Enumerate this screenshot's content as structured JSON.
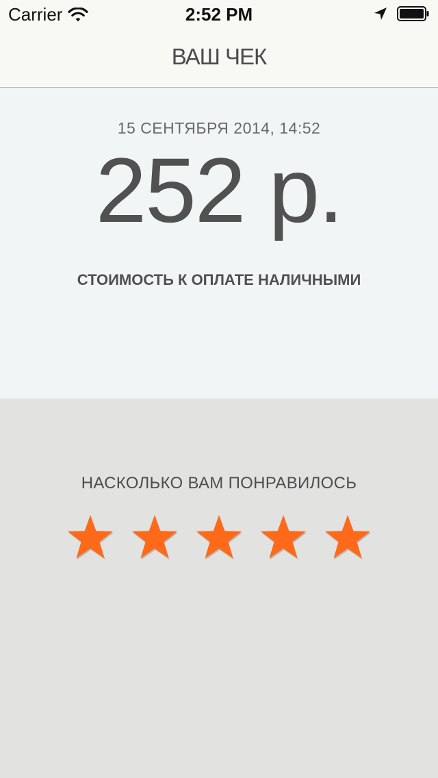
{
  "status_bar": {
    "carrier": "Carrier",
    "time": "2:52 PM",
    "icons": [
      "wifi-icon",
      "location-arrow-icon",
      "battery-icon"
    ]
  },
  "nav": {
    "title": "ВАШ ЧЕК"
  },
  "receipt": {
    "date": "15 СЕНТЯБРЯ 2014, 14:52",
    "amount": "252 р.",
    "caption": "СТОИМОСТЬ К ОПЛАТЕ НАЛИЧНЫМИ"
  },
  "rating": {
    "question": "НАСКОЛЬКО ВАМ ПОНРАВИЛОСЬ",
    "star_count": 5,
    "selected": 5,
    "star_color": "#ff6a1a"
  },
  "colors": {
    "nav_background": "#f8f8f4",
    "receipt_background": "#f2f5f6",
    "rating_background": "#e2e2e1"
  }
}
